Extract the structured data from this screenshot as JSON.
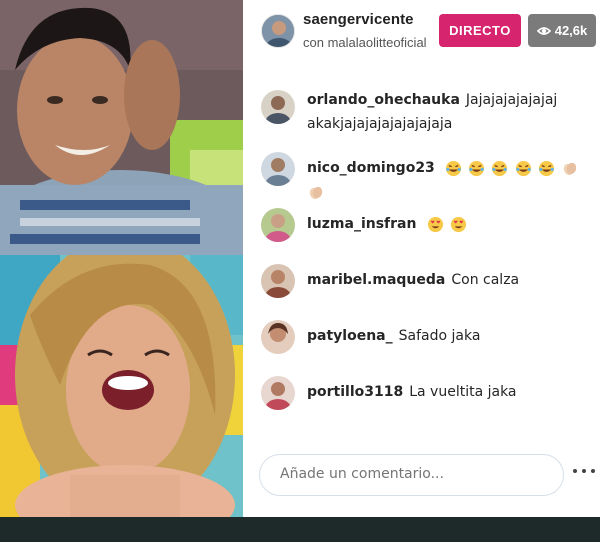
{
  "header": {
    "host_username": "saengervicente",
    "with_text": "con malalaolitteoficial",
    "live_label": "DIRECTO",
    "viewer_count": "42,6k"
  },
  "comments": [
    {
      "username": "orlando_ohechauka",
      "message": "Jajajajajajajaj akakjajajajajajajajaja"
    },
    {
      "username": "nico_domingo23",
      "message": "",
      "emojis": [
        "tears-of-joy",
        "tears-of-joy",
        "tears-of-joy",
        "tears-of-joy",
        "tears-of-joy",
        "clapping-hands",
        "clapping-hands"
      ]
    },
    {
      "username": "luzma_insfran",
      "message": "",
      "emojis": [
        "heart-eyes",
        "heart-eyes"
      ]
    },
    {
      "username": "maribel.maqueda",
      "message": "Con calza"
    },
    {
      "username": "patyloena_",
      "message": "Safado jaka"
    },
    {
      "username": "portillo3118",
      "message": "La vueltita jaka"
    }
  ],
  "comment_box": {
    "placeholder": "Añade un comentario..."
  },
  "colors": {
    "live_badge": "#d6246e",
    "viewer_badge": "#7b7b7b",
    "bottom_bar": "#1e2a2a"
  }
}
